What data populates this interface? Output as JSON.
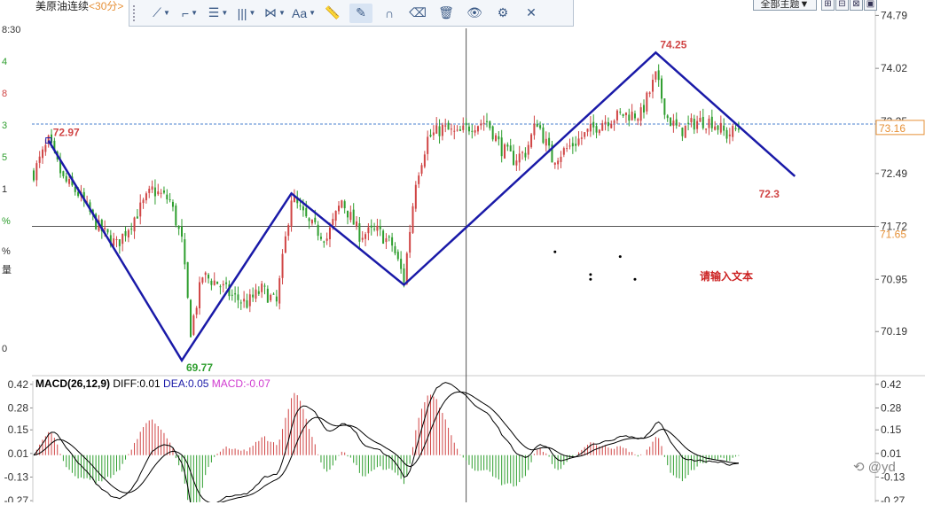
{
  "header": {
    "instrument": "美原油连续",
    "period": "<30分>",
    "theme_button": "全部主题▼"
  },
  "toolbar": {
    "items": [
      {
        "name": "line-tool",
        "glyph": "⟋",
        "caret": true
      },
      {
        "name": "polyline-tool",
        "glyph": "⌐",
        "caret": true
      },
      {
        "name": "fib-tool",
        "glyph": "☰",
        "caret": true
      },
      {
        "name": "gann-tool",
        "glyph": "|||",
        "caret": true
      },
      {
        "name": "pattern-tool",
        "glyph": "⋈",
        "caret": true
      },
      {
        "name": "text-tool",
        "glyph": "Aa",
        "caret": true
      },
      {
        "name": "ruler-tool",
        "glyph": "📏",
        "caret": false
      },
      {
        "name": "pen-tool",
        "glyph": "✎",
        "caret": false
      },
      {
        "name": "magnet-tool",
        "glyph": "∩",
        "caret": false
      },
      {
        "name": "eraser-tool",
        "glyph": "⌫",
        "caret": false
      },
      {
        "name": "trash-tool",
        "glyph": "🗑",
        "caret": false
      },
      {
        "name": "eye-tool",
        "glyph": "👁",
        "caret": false
      },
      {
        "name": "settings-tool",
        "glyph": "⚙",
        "caret": false
      },
      {
        "name": "close-tool",
        "glyph": "✕",
        "caret": false
      }
    ],
    "active_index": 7
  },
  "left_strip": [
    {
      "text": "8:30",
      "color": "#333333"
    },
    {
      "text": "4",
      "color": "#2e9e2e"
    },
    {
      "text": "8",
      "color": "#d04545"
    },
    {
      "text": "3",
      "color": "#2e9e2e"
    },
    {
      "text": "5",
      "color": "#2e9e2e"
    },
    {
      "text": "1",
      "color": "#333333"
    },
    {
      "text": "%",
      "color": "#2e9e2e"
    },
    {
      "text": "%",
      "color": "#333333"
    },
    {
      "text": "量",
      "color": "#333333"
    },
    {
      "text": "0",
      "color": "#333333"
    }
  ],
  "watermark": "@yd",
  "colors": {
    "up": "#d04545",
    "down": "#2e9e2e",
    "trend": "#1a1aa8",
    "dif": "#000000",
    "dea": "#000000",
    "macd_label": "#d03ad0",
    "price_box_border": "#e69138",
    "dashed": "#4a7fcf"
  },
  "chart_data": [
    {
      "type": "candlestick",
      "title": "",
      "ylim": [
        69.6,
        74.95
      ],
      "y_ticks": [
        "74.79",
        "74.02",
        "73.25",
        "72.49",
        "71.72",
        "70.95",
        "70.19"
      ],
      "y_tick_values": [
        74.79,
        74.02,
        73.25,
        72.49,
        71.72,
        70.95,
        70.19
      ],
      "current_price": {
        "label": "73.16",
        "value": 73.16,
        "dashed_value": 73.21
      },
      "crosshair_price": {
        "label": "71.65",
        "value": 71.72
      },
      "crosshair_bar": 146,
      "bar_count": 260,
      "trend_line": {
        "points": [
          {
            "bar": 5,
            "value": 72.97
          },
          {
            "bar": 50,
            "value": 69.77
          },
          {
            "bar": 87,
            "value": 72.2
          },
          {
            "bar": 125,
            "value": 70.87
          },
          {
            "bar": 210,
            "value": 74.25
          },
          {
            "bar": 257,
            "value": 72.45
          }
        ],
        "labels": [
          {
            "text": "72.97",
            "bar": 5,
            "value": 72.97,
            "color": "#d04545"
          },
          {
            "text": "69.77",
            "bar": 50,
            "value": 69.77,
            "color": "#2e9e2e"
          },
          {
            "text": "74.25",
            "bar": 210,
            "value": 74.25,
            "color": "#d04545"
          },
          {
            "text": "72.3",
            "bar": 252,
            "value": 72.45,
            "color": "#d04545"
          }
        ]
      },
      "annotation_text": "请输入文本",
      "dots": [
        {
          "bar": 176,
          "value": 71.35
        },
        {
          "bar": 198,
          "value": 71.28
        },
        {
          "bar": 188,
          "value": 71.02
        },
        {
          "bar": 188,
          "value": 70.95
        },
        {
          "bar": 203,
          "value": 70.95
        }
      ],
      "anchors": [
        [
          0,
          72.5
        ],
        [
          5,
          72.95
        ],
        [
          10,
          72.4
        ],
        [
          15,
          72.2
        ],
        [
          22,
          71.7
        ],
        [
          28,
          71.45
        ],
        [
          34,
          71.85
        ],
        [
          40,
          72.25
        ],
        [
          46,
          72.1
        ],
        [
          50,
          71.5
        ],
        [
          53,
          70.2
        ],
        [
          57,
          71.0
        ],
        [
          62,
          70.9
        ],
        [
          67,
          70.7
        ],
        [
          72,
          70.6
        ],
        [
          77,
          70.8
        ],
        [
          82,
          70.6
        ],
        [
          87,
          72.15
        ],
        [
          93,
          71.75
        ],
        [
          99,
          71.55
        ],
        [
          104,
          72.1
        ],
        [
          110,
          71.6
        ],
        [
          116,
          71.65
        ],
        [
          121,
          71.45
        ],
        [
          125,
          70.95
        ],
        [
          129,
          72.4
        ],
        [
          133,
          73.0
        ],
        [
          138,
          73.15
        ],
        [
          143,
          73.05
        ],
        [
          148,
          73.2
        ],
        [
          153,
          73.25
        ],
        [
          158,
          72.85
        ],
        [
          162,
          72.7
        ],
        [
          166,
          72.8
        ],
        [
          170,
          73.25
        ],
        [
          175,
          72.7
        ],
        [
          180,
          72.85
        ],
        [
          186,
          73.05
        ],
        [
          192,
          73.25
        ],
        [
          199,
          73.35
        ],
        [
          205,
          73.35
        ],
        [
          210,
          73.9
        ],
        [
          214,
          73.3
        ],
        [
          218,
          73.1
        ],
        [
          224,
          73.25
        ],
        [
          229,
          73.25
        ],
        [
          234,
          73.05
        ],
        [
          238,
          73.15
        ]
      ]
    },
    {
      "type": "macd",
      "title": "MACD(26,12,9)",
      "params": {
        "fast": 26,
        "slow": 12,
        "signal": 9
      },
      "legend": [
        {
          "label": "DIFF:",
          "value": "0.01",
          "color": "#000000"
        },
        {
          "label": "DEA:",
          "value": "0.05",
          "color": "#1a1aa8"
        },
        {
          "label": "MACD:",
          "value": "-0.07",
          "color": "#d03ad0"
        }
      ],
      "ylim": [
        -0.28,
        0.44
      ],
      "y_ticks": [
        "0.42",
        "0.28",
        "0.15",
        "0.01",
        "-0.13",
        "-0.27"
      ],
      "y_tick_values": [
        0.42,
        0.28,
        0.15,
        0.01,
        -0.13,
        -0.27
      ]
    }
  ]
}
